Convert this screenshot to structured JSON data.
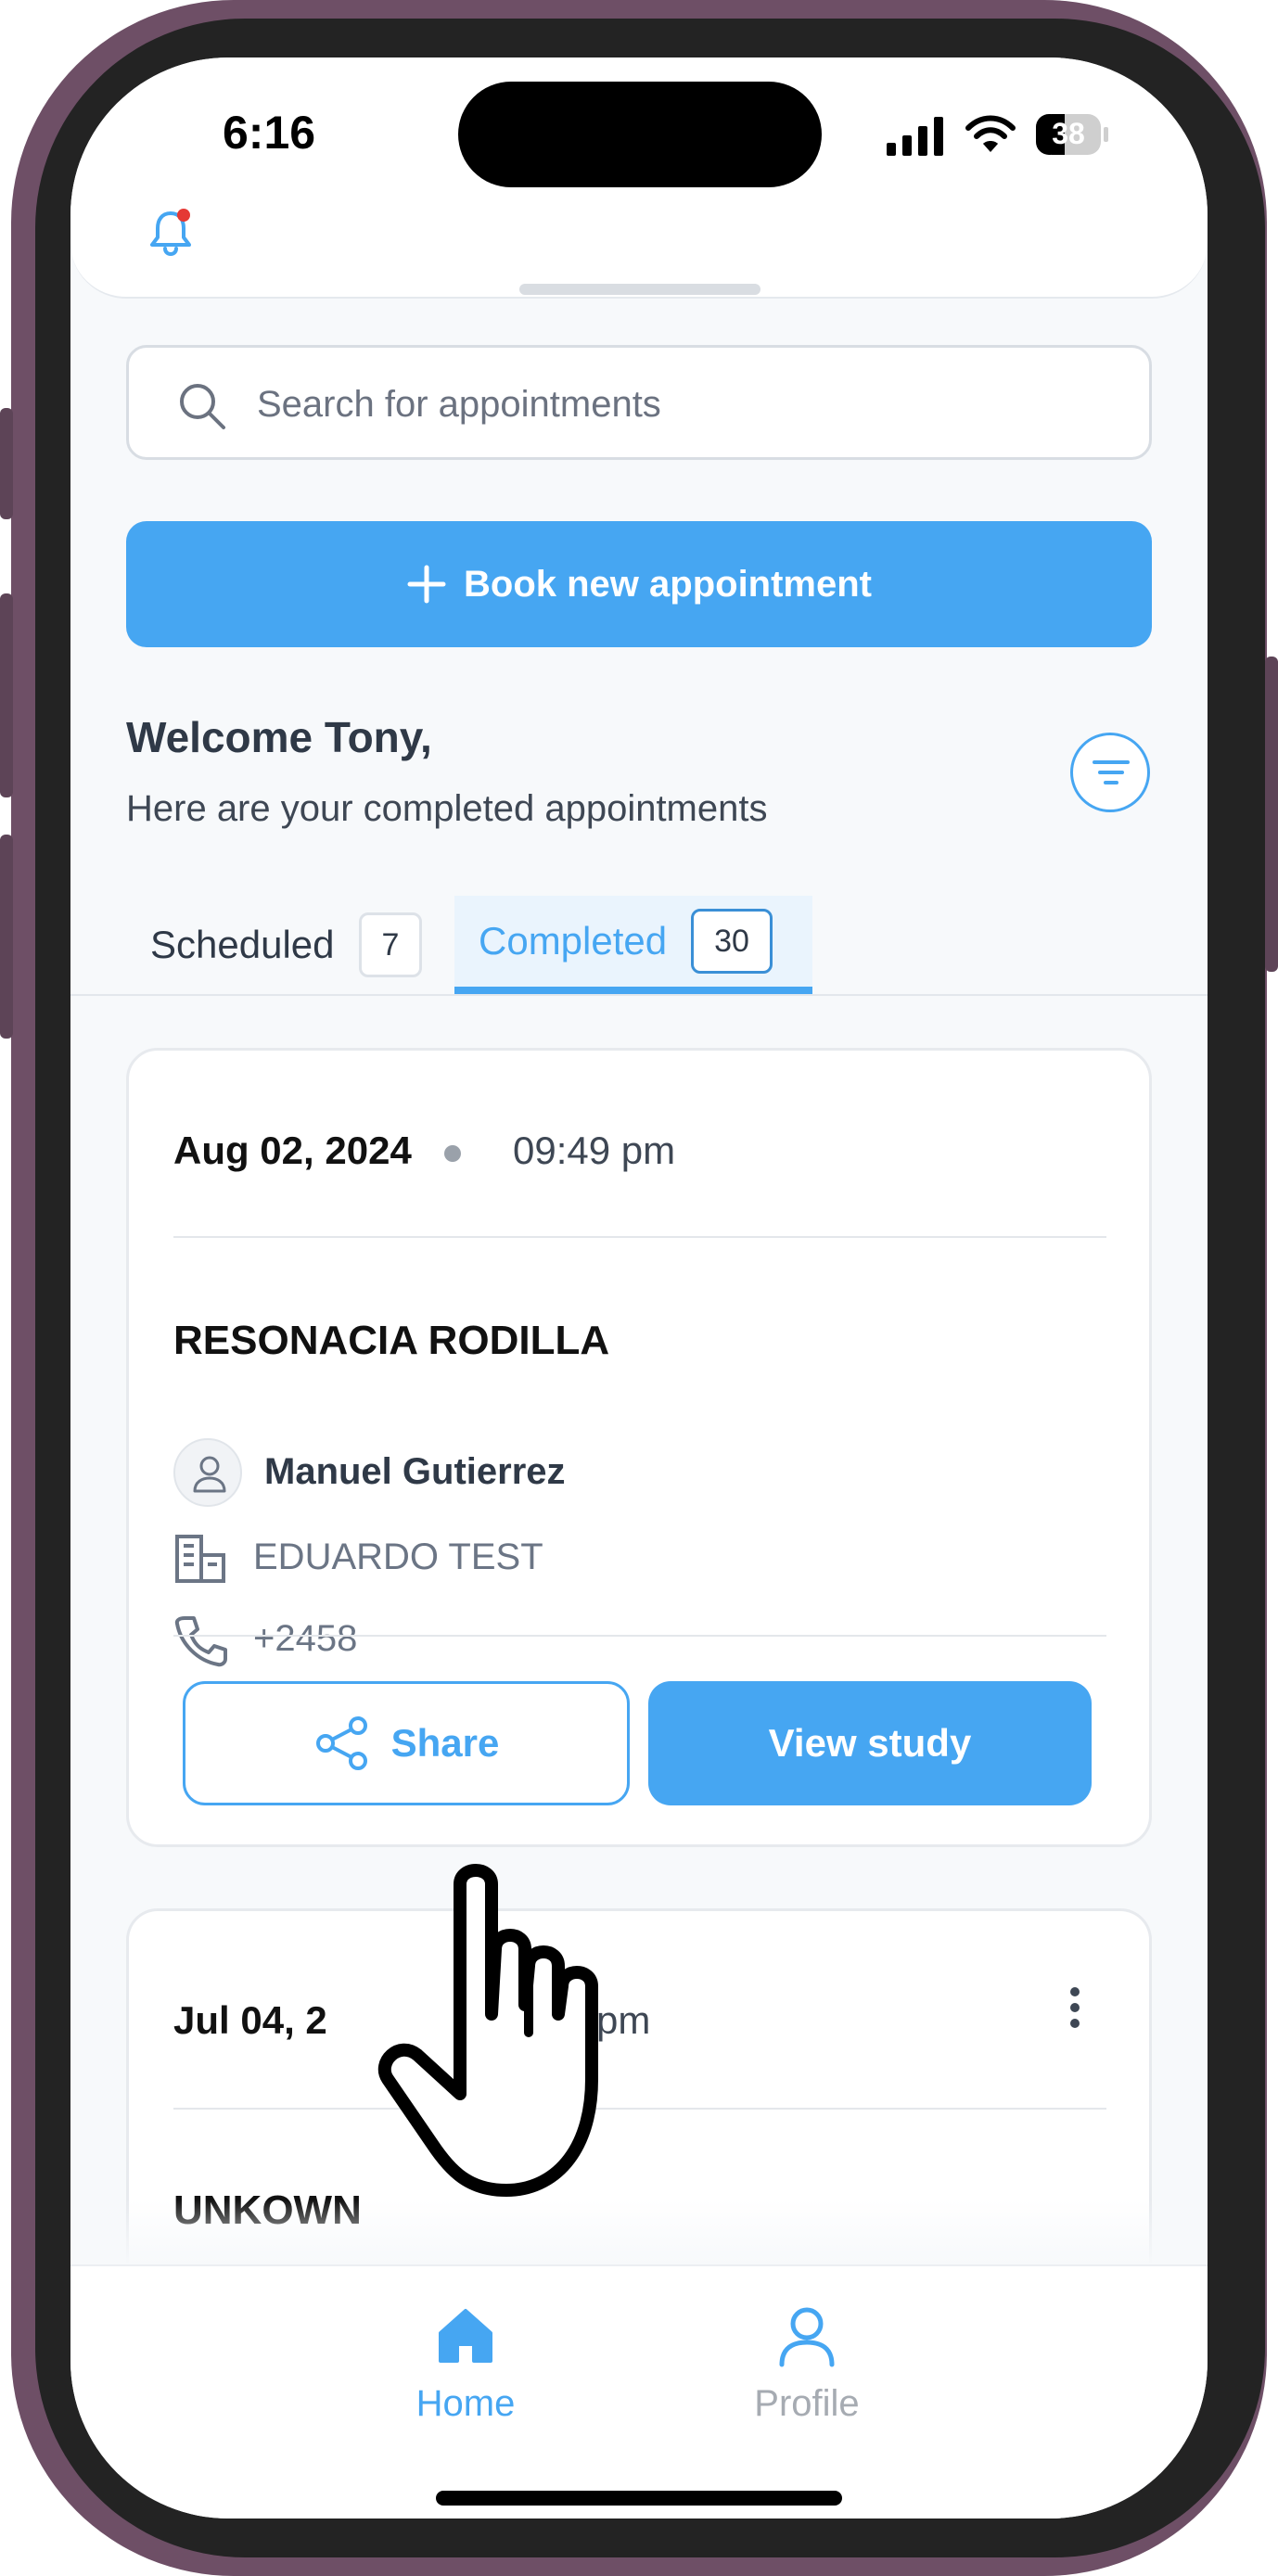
{
  "status_bar": {
    "time": "6:16",
    "battery": "38",
    "icons": [
      "signal-icon",
      "wifi-icon",
      "battery-icon"
    ]
  },
  "header": {
    "notification_icon": "bell-icon",
    "has_unread": true
  },
  "search": {
    "placeholder": "Search for appointments"
  },
  "book_button": {
    "label": "Book new appointment"
  },
  "welcome": {
    "greeting": "Welcome Tony,",
    "subtitle": "Here are your completed appointments"
  },
  "tabs": [
    {
      "label": "Scheduled",
      "count": "7",
      "active": false
    },
    {
      "label": "Completed",
      "count": "30",
      "active": true
    }
  ],
  "appointments": [
    {
      "date": "Aug 02, 2024",
      "time": "09:49 pm",
      "study": "RESONACIA RODILLA",
      "doctor": "Manuel Gutierrez",
      "organization": "EDUARDO TEST",
      "phone": "+2458",
      "share_label": "Share",
      "view_label": "View study"
    },
    {
      "date": "Jul 04, 2",
      "time": "pm",
      "study": "UNKOWN"
    }
  ],
  "bottom_nav": [
    {
      "label": "Home",
      "icon": "home-icon",
      "active": true
    },
    {
      "label": "Profile",
      "icon": "profile-icon",
      "active": false
    }
  ],
  "colors": {
    "accent": "#46a6f2",
    "text_dark": "#2f3947",
    "background": "#f7f9fb"
  }
}
